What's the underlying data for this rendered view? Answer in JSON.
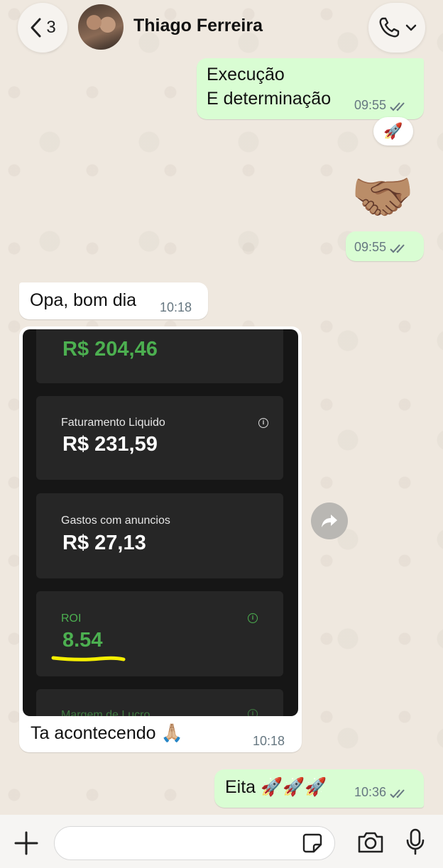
{
  "header": {
    "back_count": "3",
    "contact_name": "Thiago Ferreira"
  },
  "messages": {
    "m1": {
      "line1": "Execução",
      "line2": "E determinação",
      "time": "09:55",
      "reaction": "🚀"
    },
    "m2": {
      "emoji": "🤝🏽",
      "time": "09:55"
    },
    "m3": {
      "text": "Opa, bom dia",
      "time": "10:18"
    },
    "m4": {
      "caption": "Ta acontecendo 🙏🏼",
      "time": "10:18",
      "screenshot": {
        "top_value": "R$ 204,46",
        "cards": [
          {
            "label": "Faturamento Liquido",
            "value": "R$ 231,59"
          },
          {
            "label": "Gastos com anuncios",
            "value": "R$ 27,13"
          },
          {
            "label": "ROI",
            "value": "8.54"
          },
          {
            "label": "Margem de Lucro"
          }
        ]
      }
    },
    "m5": {
      "text": "Eita 🚀🚀🚀",
      "time": "10:36"
    }
  },
  "composer": {
    "input_value": ""
  },
  "colors": {
    "outgoing_bubble": "#d9fdd3",
    "incoming_bubble": "#ffffff",
    "green_value": "#4caf50",
    "highlight": "#f5ef00",
    "read_ticks": "#667781"
  },
  "icons": [
    "chevron-left-icon",
    "phone-icon",
    "chevron-down-icon",
    "plus-icon",
    "sticker-icon",
    "camera-icon",
    "microphone-icon",
    "forward-icon",
    "info-icon",
    "double-check-icon"
  ]
}
